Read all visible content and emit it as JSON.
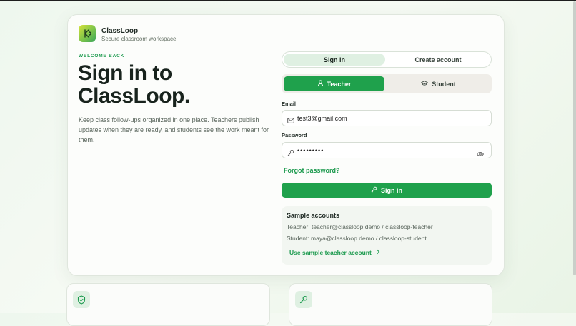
{
  "brand": {
    "name": "ClassLoop",
    "subtitle": "Secure classroom workspace"
  },
  "hero": {
    "eyebrow": "WELCOME BACK",
    "headline": "Sign in to ClassLoop.",
    "lead": "Keep class follow-ups organized in one place. Teachers publish updates when they are ready, and students see the work meant for them."
  },
  "auth_tabs": {
    "sign_in": "Sign in",
    "create_account": "Create account",
    "active": "sign_in"
  },
  "roles": {
    "teacher": "Teacher",
    "student": "Student",
    "active": "teacher"
  },
  "form": {
    "email_label": "Email",
    "email_value": "test3@gmail.com",
    "password_label": "Password",
    "password_value": "•••••••••",
    "forgot_password": "Forgot password?",
    "submit": "Sign in"
  },
  "samples": {
    "title": "Sample accounts",
    "teacher": "Teacher: teacher@classloop.demo / classloop-teacher",
    "student": "Student: maya@classloop.demo / classloop-student",
    "use_link": "Use sample teacher account"
  },
  "icons": {
    "logo": "classloop-logo-icon",
    "teacher": "user-icon",
    "student": "graduation-cap-icon",
    "email": "mail-icon",
    "password": "key-icon",
    "toggle": "eye-icon",
    "submit": "key-icon",
    "link": "chevron-right-icon"
  },
  "colors": {
    "accent": "#1fa14c",
    "accent_text": "#1c9a4e",
    "tab_active": "#dff0e2"
  }
}
